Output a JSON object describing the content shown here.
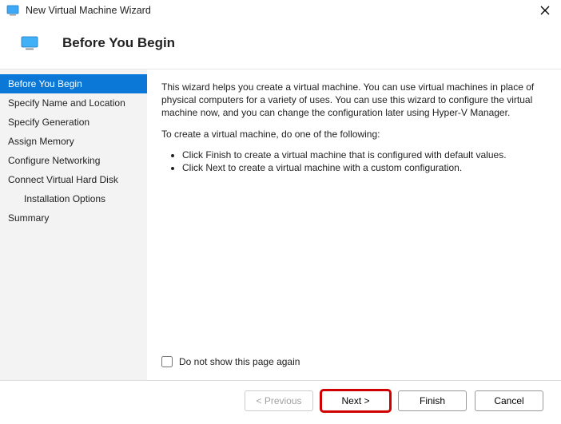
{
  "window": {
    "title": "New Virtual Machine Wizard"
  },
  "header": {
    "title": "Before You Begin"
  },
  "sidebar": {
    "items": [
      {
        "label": "Before You Begin",
        "active": true,
        "sub": false
      },
      {
        "label": "Specify Name and Location",
        "active": false,
        "sub": false
      },
      {
        "label": "Specify Generation",
        "active": false,
        "sub": false
      },
      {
        "label": "Assign Memory",
        "active": false,
        "sub": false
      },
      {
        "label": "Configure Networking",
        "active": false,
        "sub": false
      },
      {
        "label": "Connect Virtual Hard Disk",
        "active": false,
        "sub": false
      },
      {
        "label": "Installation Options",
        "active": false,
        "sub": true
      },
      {
        "label": "Summary",
        "active": false,
        "sub": false
      }
    ]
  },
  "main": {
    "intro": "This wizard helps you create a virtual machine. You can use virtual machines in place of physical computers for a variety of uses. You can use this wizard to configure the virtual machine now, and you can change the configuration later using Hyper-V Manager.",
    "prompt": "To create a virtual machine, do one of the following:",
    "bullets": [
      "Click Finish to create a virtual machine that is configured with default values.",
      "Click Next to create a virtual machine with a custom configuration."
    ],
    "checkbox_label": "Do not show this page again"
  },
  "footer": {
    "previous": "< Previous",
    "next": "Next >",
    "finish": "Finish",
    "cancel": "Cancel"
  }
}
